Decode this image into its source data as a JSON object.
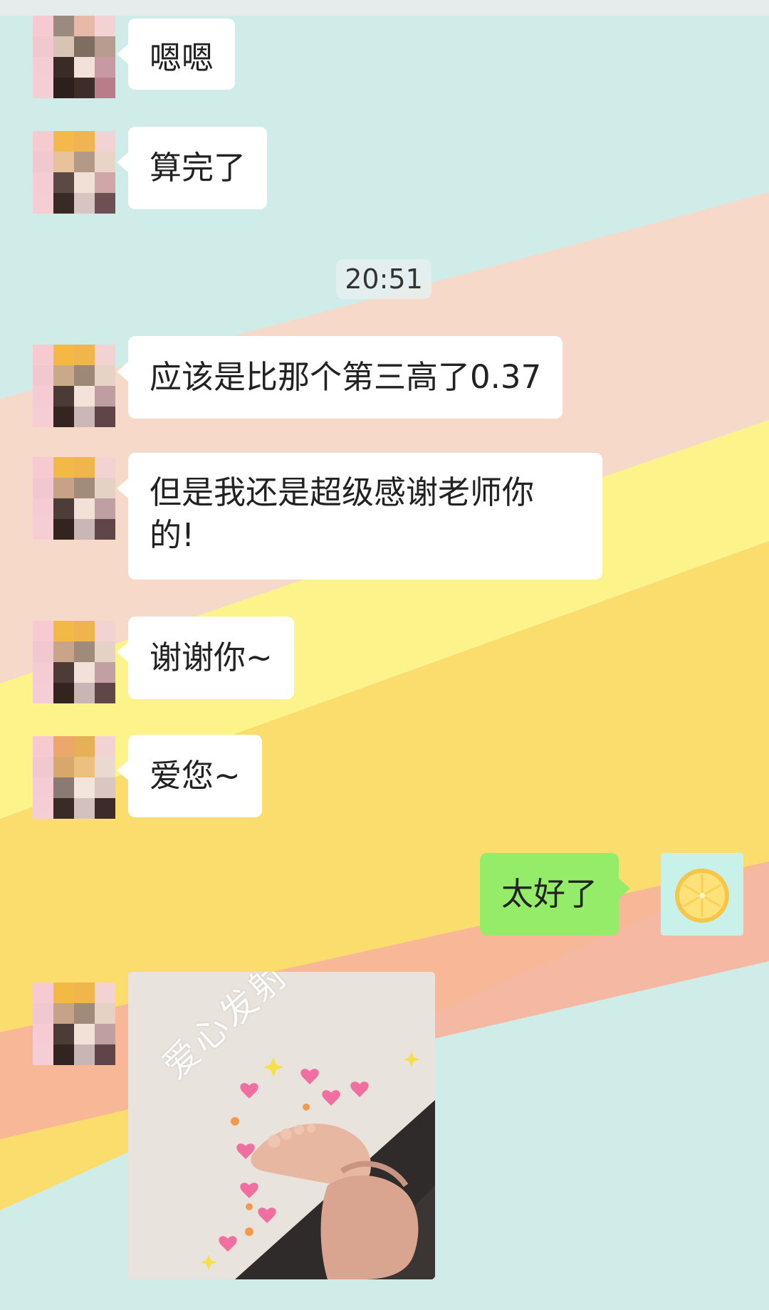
{
  "timestamp": "20:51",
  "messages": [
    {
      "side": "left",
      "text": "嗯嗯"
    },
    {
      "side": "left",
      "text": "算完了"
    },
    {
      "side": "left",
      "text": "应该是比那个第三高了0.37"
    },
    {
      "side": "left",
      "text": "但是我还是超级感谢老师你\n的!"
    },
    {
      "side": "left",
      "text": "谢谢你~"
    },
    {
      "side": "left",
      "text": "爱您~"
    },
    {
      "side": "right",
      "text": "太好了"
    }
  ],
  "photo_message": {
    "caption": "爱心发射"
  },
  "colors": {
    "self_bubble": "#95ec69",
    "other_bubble": "#ffffff",
    "bg_cyan": "#cfece8",
    "bg_peach": "#f6d9c8",
    "bg_yellow": "#fcf48a",
    "bg_amber": "#fbdd6e",
    "bg_salmon": "#f7b39b"
  },
  "icons": {
    "self_avatar": "orange-slice-icon",
    "contact_avatar": "pixelated-avatar-icon",
    "photo_hearts": "heart-icon"
  }
}
